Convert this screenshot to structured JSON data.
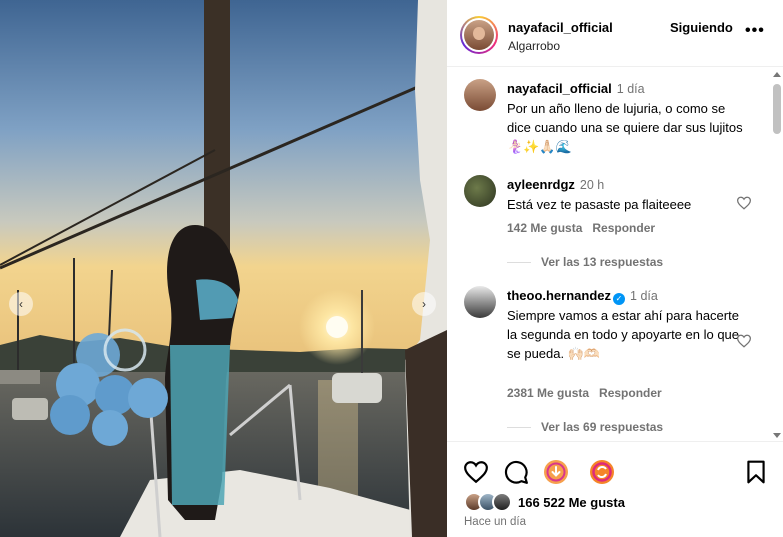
{
  "post": {
    "username": "nayafacil_official",
    "location": "Algarrobo",
    "follow_label": "Siguiendo",
    "more_label": "•••"
  },
  "media": {
    "prev_label": "‹",
    "next_label": "›"
  },
  "caption": {
    "username": "nayafacil_official",
    "time": "1 día",
    "text": "Por un año lleno de lujuria, o como se dice cuando una se quiere dar sus lujitos 🧜🏻‍♀️✨🙏🏻🌊"
  },
  "comments": [
    {
      "username": "ayleenrdgz",
      "time": "20 h",
      "text": "Está vez te pasaste pa flaiteeee",
      "likes": "142 Me gusta",
      "reply_label": "Responder",
      "replies": "Ver las 13 respuestas"
    },
    {
      "username": "theoo.hernandez",
      "verified": "✓",
      "time": "1 día",
      "text": "Siempre vamos a estar ahí para hacerte la segunda en todo y apoyarte en lo que se pueda. 🙌🏻🫶🏻",
      "likes": "2381 Me gusta",
      "reply_label": "Responder",
      "replies": "Ver las 69 respuestas"
    }
  ],
  "actions": {
    "icons": [
      "heart-icon",
      "comment-icon",
      "share-icon",
      "repost-icon",
      "save-icon"
    ],
    "likes_count": "166 522 Me gusta",
    "posted": "Hace un día"
  },
  "colors": {
    "accent_blue": "#0095f6",
    "muted": "#737373",
    "story_ring": "#ee2a7b"
  }
}
